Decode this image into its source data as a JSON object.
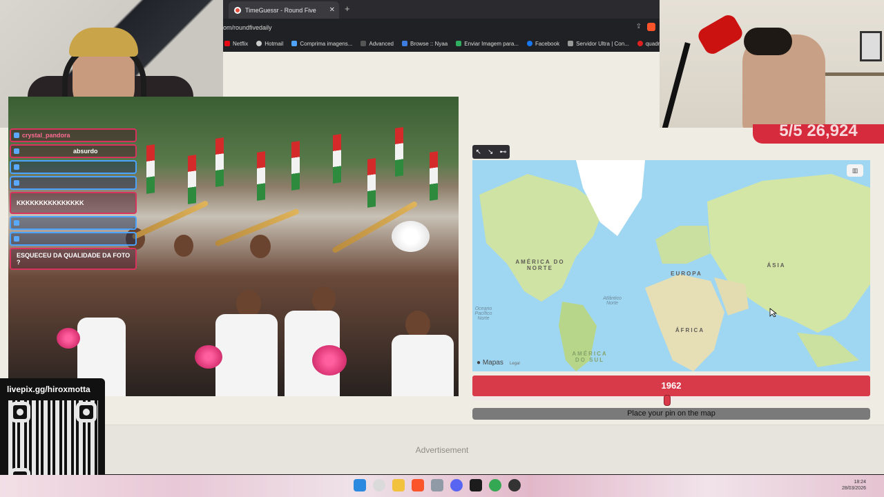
{
  "browser": {
    "tab_title": "TimeGuessr - Round Five",
    "tab_close": "✕",
    "new_tab": "+",
    "url": "om/roundfivedaily",
    "bookmarks": [
      {
        "label": "Netflix"
      },
      {
        "label": "Hotmail"
      },
      {
        "label": "Comprima imagens..."
      },
      {
        "label": "Advanced"
      },
      {
        "label": "Browse :: Nyaa"
      },
      {
        "label": "Enviar Imagem para..."
      },
      {
        "label": "Facebook"
      },
      {
        "label": "Servidor Ultra | Con..."
      },
      {
        "label": "quadri"
      }
    ]
  },
  "game": {
    "score": "5/5 26,924",
    "year": "1962",
    "year_fraction": 0.49,
    "place_pin_label": "Place your pin on the map",
    "advertisement": "Advertisement"
  },
  "map": {
    "labels": {
      "north_america": "AMÉRICA DO NORTE",
      "europe": "EUROPA",
      "asia": "ÁSIA",
      "africa": "ÁFRICA",
      "south_america": "AMÉRICA DO SUL",
      "atlantic": "Atlântico Norte",
      "pacific": "Oceano Pacífico Norte"
    },
    "attribution": "Mapas",
    "legal": "Legal",
    "toggle_icon": "▥"
  },
  "chat": [
    {
      "user": "crystal_pandora",
      "text": "",
      "style": "pink"
    },
    {
      "user": "",
      "text": "absurdo",
      "style": "pink"
    },
    {
      "user": "",
      "text": "",
      "style": "blue"
    },
    {
      "user": "",
      "text": "",
      "style": "blue"
    },
    {
      "user": "",
      "text": "KKKKKKKKKKKKKKK",
      "style": "pink"
    },
    {
      "user": "",
      "text": "",
      "style": "blue"
    },
    {
      "user": "",
      "text": "",
      "style": "blue"
    },
    {
      "user": "",
      "text": "ESQUECEU DA QUALIDADE DA FOTO ?",
      "style": "pink"
    }
  ],
  "overlay": {
    "livepix": "livepix.gg/hiroxmotta"
  },
  "taskbar": {
    "time": "18:24",
    "date": "28/03/2026"
  },
  "colors": {
    "accent_red": "#d83a49",
    "map_ocean": "#9fd6f2",
    "page_bg": "#eeece3"
  }
}
